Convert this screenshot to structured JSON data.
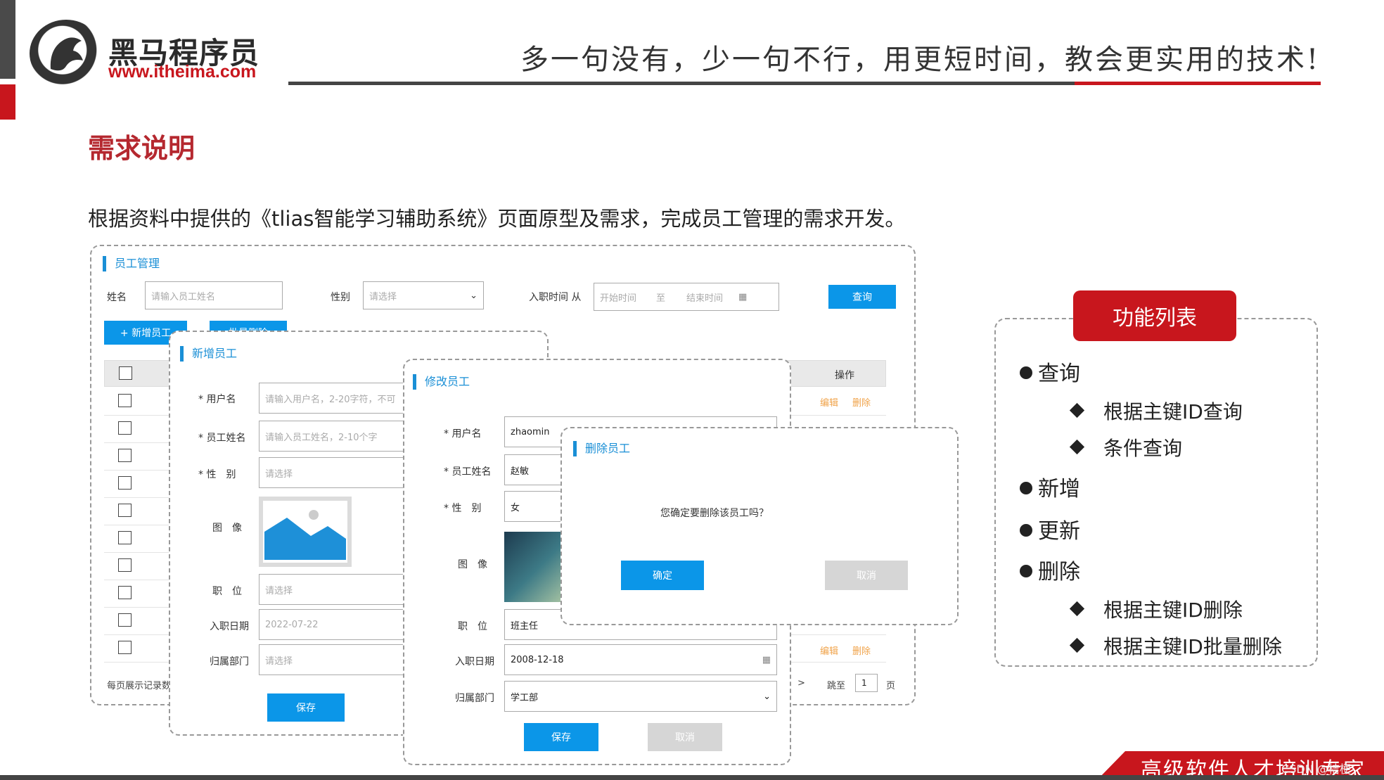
{
  "brand": {
    "name": "黑马程序员",
    "url": "www.itheima.com"
  },
  "slogan": "多一句没有，少一句不行，用更短时间，教会更实用的技术!",
  "section_title": "需求说明",
  "intro": "根据资料中提供的《tlias智能学习辅助系统》页面原型及需求，完成员工管理的需求开发。",
  "main_panel": {
    "title": "员工管理",
    "name_label": "姓名",
    "name_placeholder": "请输入员工姓名",
    "gender_label": "性别",
    "gender_placeholder": "请选择",
    "entry_label": "入职时间 从",
    "start_placeholder": "开始时间",
    "to_label": "至",
    "end_placeholder": "结束时间",
    "query_button": "查询",
    "add_button": "+ 新增员工",
    "batch_button": "批量删除",
    "col_operation": "操作",
    "edit_link": "编辑",
    "delete_link": "删除",
    "page_size_label": "每页展示记录数",
    "next_arrow": ">",
    "jump_label": "跳至",
    "jump_value": "1",
    "page_label": "页"
  },
  "add_dialog": {
    "title": "新增员工",
    "username_label": "* 用户名",
    "username_placeholder": "请输入用户名，2-20字符，不可",
    "realname_label": "* 员工姓名",
    "realname_placeholder": "请输入员工姓名，2-10个字",
    "gender_label": "* 性　别",
    "gender_placeholder": "请选择",
    "image_label": "图　像",
    "job_label": "职　位",
    "job_placeholder": "请选择",
    "date_label": "入职日期",
    "date_placeholder": "2022-07-22",
    "dept_label": "归属部门",
    "dept_placeholder": "请选择",
    "save_button": "保存"
  },
  "edit_dialog": {
    "title": "修改员工",
    "username_label": "* 用户名",
    "username_value": "zhaomin",
    "realname_label": "* 员工姓名",
    "realname_value": "赵敏",
    "gender_label": "* 性　别",
    "gender_value": "女",
    "image_label": "图　像",
    "job_label": "职　位",
    "job_value": "班主任",
    "date_label": "入职日期",
    "date_value": "2008-12-18",
    "dept_label": "归属部门",
    "dept_value": "学工部",
    "save_button": "保存",
    "cancel_button": "取消"
  },
  "delete_dialog": {
    "title": "删除员工",
    "message": "您确定要删除该员工吗？",
    "confirm_button": "确定",
    "cancel_button": "取消"
  },
  "features": {
    "badge": "功能列表",
    "items": [
      {
        "label": "查询",
        "subs": [
          "根据主键ID查询",
          "条件查询"
        ]
      },
      {
        "label": "新增",
        "subs": []
      },
      {
        "label": "更新",
        "subs": []
      },
      {
        "label": "删除",
        "subs": [
          "根据主键ID删除",
          "根据主键ID批量删除"
        ]
      }
    ]
  },
  "footer": {
    "text": "高级软件人才培训专家",
    "watermark": "CSDN @桔梗"
  },
  "colors": {
    "brand_red": "#c8161d",
    "accent_blue": "#0b96e8",
    "link_orange": "#f0a34a"
  }
}
